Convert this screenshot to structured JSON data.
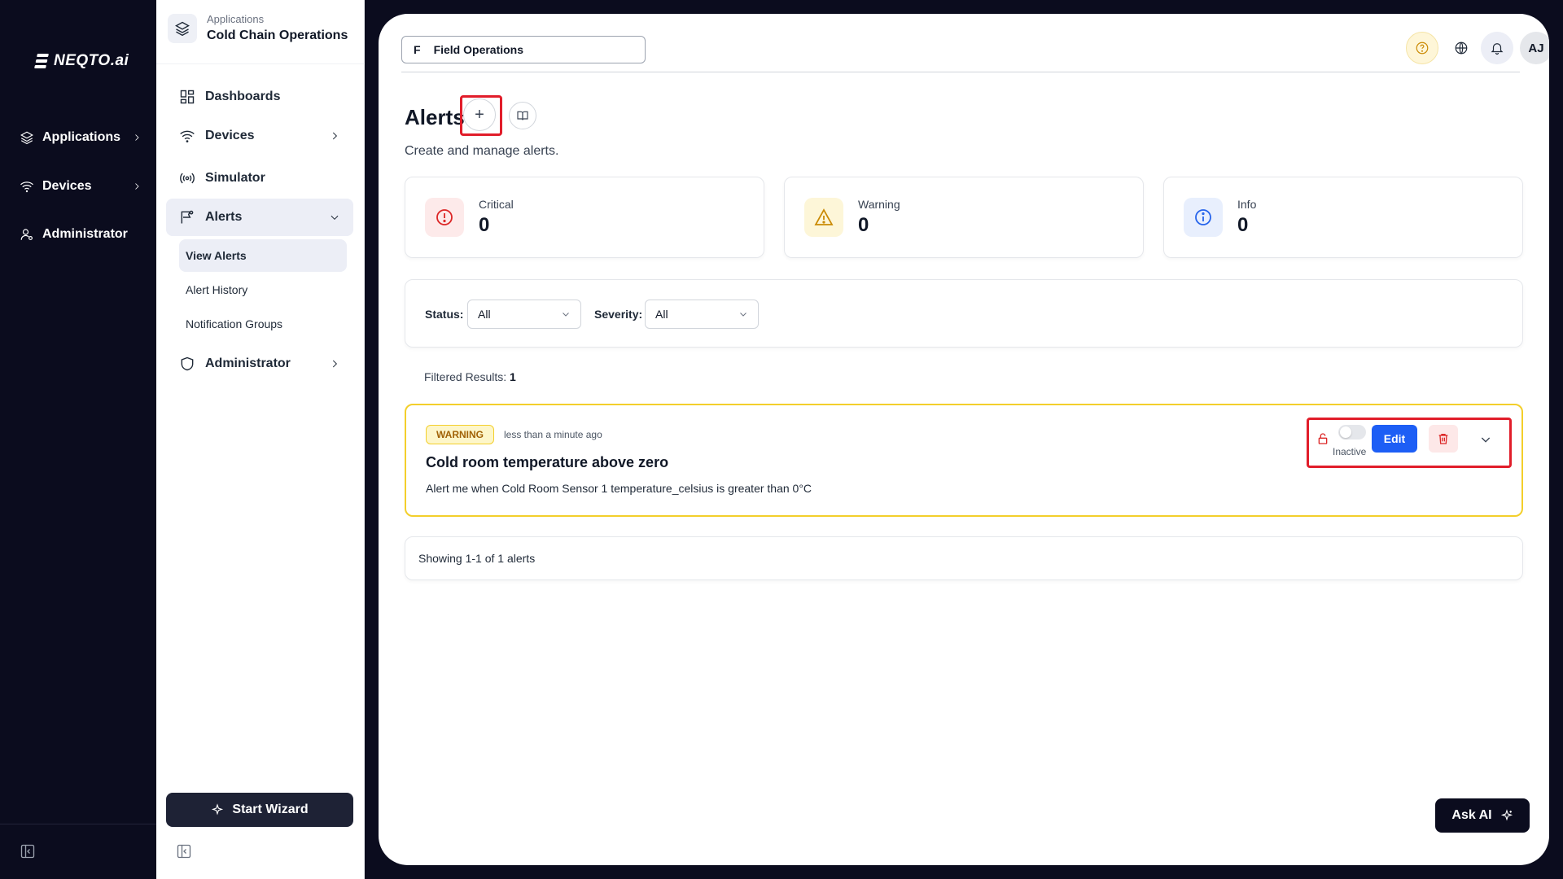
{
  "brand": {
    "name": "NEQTO.ai"
  },
  "rail": {
    "items": [
      {
        "label": "Applications",
        "icon": "layers-icon"
      },
      {
        "label": "Devices",
        "icon": "wifi-icon"
      },
      {
        "label": "Administrator",
        "icon": "user-cog-icon"
      }
    ]
  },
  "sidebar": {
    "app_section": "Applications",
    "app_name": "Cold Chain Operations",
    "items": [
      {
        "label": "Dashboards",
        "icon": "dashboard-grid-icon"
      },
      {
        "label": "Devices",
        "icon": "wifi-icon"
      },
      {
        "label": "Simulator",
        "icon": "broadcast-icon"
      },
      {
        "label": "Alerts",
        "icon": "flag-message-icon"
      },
      {
        "label": "Administrator",
        "icon": "shield-icon"
      }
    ],
    "alert_sub_items": [
      "View Alerts",
      "Alert History",
      "Notification Groups"
    ],
    "wizard_label": "Start Wizard"
  },
  "topbar": {
    "workspace_letter": "F",
    "workspace_name": "Field Operations",
    "avatar_initials": "AJ"
  },
  "page": {
    "title": "Alerts",
    "subtitle": "Create and manage alerts."
  },
  "stats": [
    {
      "label": "Critical",
      "value": "0",
      "color": "#dc2626"
    },
    {
      "label": "Warning",
      "value": "0",
      "color": "#ca8a04"
    },
    {
      "label": "Info",
      "value": "0",
      "color": "#2563eb"
    }
  ],
  "filters": {
    "status_label": "Status:",
    "status_value": "All",
    "severity_label": "Severity:",
    "severity_value": "All"
  },
  "results": {
    "label": "Filtered Results:",
    "count": "1",
    "showing": "Showing 1-1 of 1 alerts"
  },
  "alert": {
    "severity": "WARNING",
    "time": "less than a minute ago",
    "title": "Cold room temperature above zero",
    "description": "Alert me when Cold Room Sensor 1 temperature_celsius is greater than 0°C",
    "status_label": "Inactive",
    "edit_label": "Edit"
  },
  "ask_ai": {
    "label": "Ask AI"
  },
  "colors": {
    "accent": "#1d5ef5",
    "dark": "#0b0c1e",
    "warning_border": "#f3cf2b",
    "highlight": "#e11d2a"
  }
}
